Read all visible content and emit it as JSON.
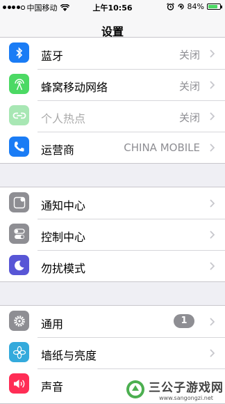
{
  "status_bar": {
    "carrier": "中国移动",
    "time": "上午10:56",
    "battery": "84%",
    "battery_level": 0.84
  },
  "nav": {
    "title": "设置"
  },
  "groups": [
    {
      "rows": [
        {
          "label": "蓝牙",
          "value": "关闭",
          "icon": "bluetooth-icon",
          "color": "#1a7cf5"
        },
        {
          "label": "蜂窝移动网络",
          "value": "关闭",
          "icon": "cellular-icon",
          "color": "#4cd964"
        },
        {
          "label": "个人热点",
          "value": "关闭",
          "icon": "hotspot-icon",
          "color": "#a8e7b4",
          "disabled": true
        },
        {
          "label": "运营商",
          "value": "CHINA MOBILE",
          "icon": "phone-icon",
          "color": "#1a7cf5"
        }
      ]
    },
    {
      "rows": [
        {
          "label": "通知中心",
          "icon": "notification-center-icon",
          "color": "#8e8e93"
        },
        {
          "label": "控制中心",
          "icon": "control-center-icon",
          "color": "#8e8e93"
        },
        {
          "label": "勿扰模式",
          "icon": "moon-icon",
          "color": "#5856d6"
        }
      ]
    },
    {
      "rows": [
        {
          "label": "通用",
          "badge": "1",
          "icon": "gear-icon",
          "color": "#8e8e93"
        },
        {
          "label": "墙纸与亮度",
          "icon": "flower-icon",
          "color": "#34aadc"
        },
        {
          "label": "声音",
          "icon": "speaker-icon",
          "color": "#ff2d55"
        }
      ]
    }
  ],
  "watermark": {
    "name": "三公子游戏网",
    "url": "www.sangongzi.net"
  }
}
